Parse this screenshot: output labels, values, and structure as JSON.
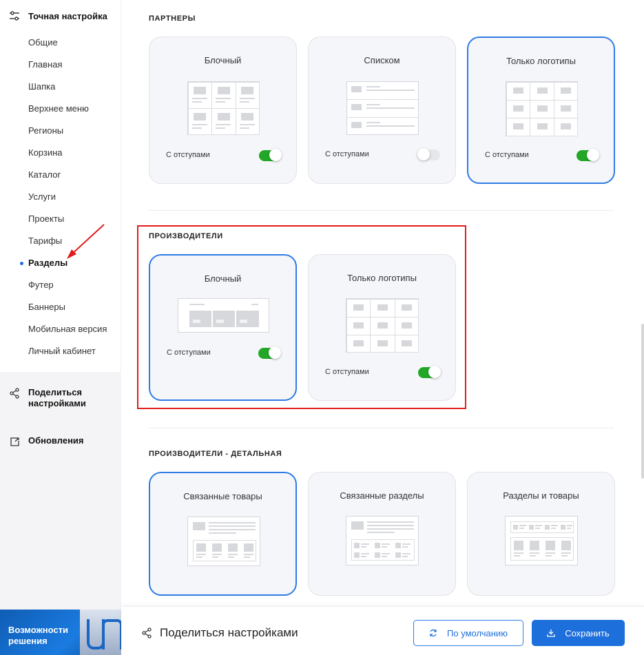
{
  "sidebar": {
    "heading": "Точная настройка",
    "items": [
      {
        "label": "Общие"
      },
      {
        "label": "Главная"
      },
      {
        "label": "Шапка"
      },
      {
        "label": "Верхнее меню"
      },
      {
        "label": "Регионы"
      },
      {
        "label": "Корзина"
      },
      {
        "label": "Каталог"
      },
      {
        "label": "Услуги"
      },
      {
        "label": "Проекты"
      },
      {
        "label": "Тарифы"
      },
      {
        "label": "Разделы",
        "active": true
      },
      {
        "label": "Футер"
      },
      {
        "label": "Баннеры"
      },
      {
        "label": "Мобильная версия"
      },
      {
        "label": "Личный кабинет"
      }
    ],
    "share_settings": "Поделиться настройками",
    "updates": "Обновления",
    "banner": "Возможности решения"
  },
  "sections": {
    "partners": {
      "title": "ПАРТНЕРЫ",
      "cards": [
        {
          "title": "Блочный",
          "option": "С отступами",
          "toggle": "on",
          "selected": false
        },
        {
          "title": "Списком",
          "option": "С отступами",
          "toggle": "off",
          "selected": false
        },
        {
          "title": "Только логотипы",
          "option": "С отступами",
          "toggle": "on",
          "selected": true
        }
      ]
    },
    "manufacturers": {
      "title": "ПРОИЗВОДИТЕЛИ",
      "cards": [
        {
          "title": "Блочный",
          "option": "С отступами",
          "toggle": "on",
          "selected": true
        },
        {
          "title": "Только логотипы",
          "option": "С отступами",
          "toggle": "on",
          "selected": false
        }
      ]
    },
    "manufacturers_detail": {
      "title": "ПРОИЗВОДИТЕЛИ - ДЕТАЛЬНАЯ",
      "cards": [
        {
          "title": "Связанные товары",
          "selected": true
        },
        {
          "title": "Связанные разделы",
          "selected": false
        },
        {
          "title": "Разделы и товары",
          "selected": false
        }
      ]
    }
  },
  "footer": {
    "share_label": "Поделиться настройками",
    "default_button": "По умолчанию",
    "save_button": "Сохранить"
  },
  "colors": {
    "accent": "#1d6fdc",
    "toggle_on": "#22a826",
    "highlight": "#e01c1c",
    "card_bg": "#f5f6fa"
  }
}
